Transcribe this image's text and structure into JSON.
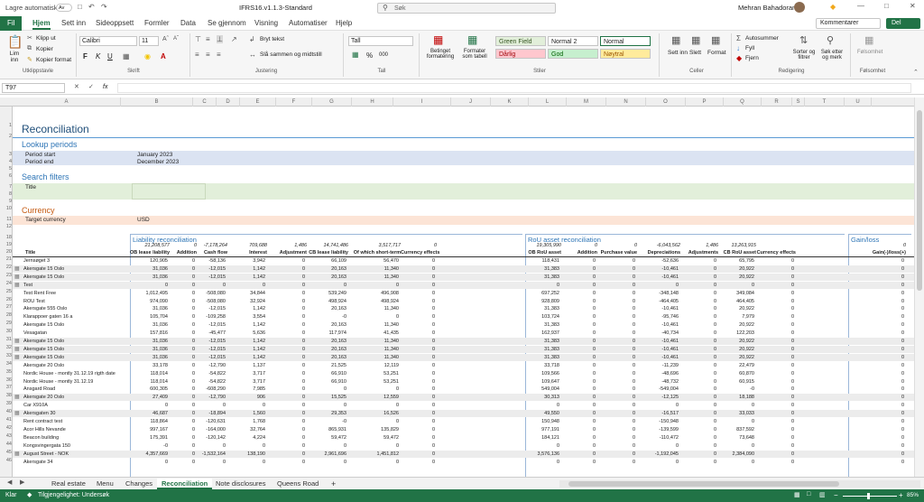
{
  "title_bar": {
    "autosave_label": "Lagre automatisk",
    "autosave_state": "Av",
    "filename": "IFRS16.v1.1.3-Standard",
    "search_placeholder": "Søk",
    "user": "Mehran Bahadoran"
  },
  "menu": {
    "items": [
      "Fil",
      "Hjem",
      "Sett inn",
      "Sideoppsett",
      "Formler",
      "Data",
      "Se gjennom",
      "Visning",
      "Automatiser",
      "Hjelp"
    ],
    "comments": "Kommentarer",
    "share": "Del"
  },
  "ribbon": {
    "clipboard": {
      "paste": "Lim inn",
      "cut": "Klipp ut",
      "copy": "Kopier",
      "format_painter": "Kopier format",
      "group": "Utklippstavle"
    },
    "font": {
      "name": "Calibri",
      "size": "11",
      "bold": "F",
      "italic": "K",
      "underline": "U",
      "group": "Skrift"
    },
    "alignment": {
      "wrap": "Bryt tekst",
      "merge": "Slå sammen og midtstill",
      "group": "Justering"
    },
    "number": {
      "format": "Tall",
      "percent": "%",
      "thousands": "000",
      "group": "Tall"
    },
    "styles": {
      "cond_format": "Betinget formatering",
      "format_table": "Formater som tabell",
      "cells": [
        {
          "label": "Green Field",
          "bg": "#e2efda",
          "fg": "#375623"
        },
        {
          "label": "Normal 2",
          "bg": "#ffffff",
          "fg": "#222222"
        },
        {
          "label": "Normal",
          "bg": "#ffffff",
          "fg": "#222222"
        },
        {
          "label": "Dårlig",
          "bg": "#ffc7ce",
          "fg": "#9c0006"
        },
        {
          "label": "God",
          "bg": "#c6efce",
          "fg": "#006100"
        },
        {
          "label": "Nøytral",
          "bg": "#ffeb9c",
          "fg": "#9c5700"
        }
      ],
      "group": "Stiler"
    },
    "cells": {
      "insert": "Sett inn",
      "delete": "Slett",
      "format": "Format",
      "group": "Celler"
    },
    "editing": {
      "autosum": "Autosummer",
      "fill": "Fyll",
      "clear": "Fjern",
      "sort": "Sorter og filtrer",
      "find": "Søk etter og merk",
      "group": "Redigering"
    },
    "sensitivity": {
      "label": "Følsomhet",
      "group": "Følsomhet"
    }
  },
  "formula_bar": {
    "name_box": "T97",
    "fx": "fx",
    "content": ""
  },
  "columns": [
    "A",
    "B",
    "C",
    "D",
    "E",
    "F",
    "G",
    "H",
    "I",
    "J",
    "K",
    "L",
    "M",
    "N",
    "O",
    "P",
    "Q",
    "R",
    "S",
    "T",
    "U"
  ],
  "sheet": {
    "title": "Reconciliation",
    "lookup": {
      "heading": "Lookup periods",
      "start_label": "Period start",
      "start_value": "January 2023",
      "end_label": "Period end",
      "end_value": "December 2023"
    },
    "search": {
      "heading": "Search filters",
      "title_label": "Title"
    },
    "currency": {
      "heading": "Currency",
      "label": "Target currency",
      "value": "USD"
    },
    "liability_heading": "Liability reconciliation",
    "rou_heading": "RoU asset reconciliation",
    "gain_heading": "Gain/loss",
    "liability_totals": [
      "21,208,577",
      "0",
      "-7,178,264",
      "709,688",
      "1,486",
      "14,741,486",
      "3,517,717",
      "0"
    ],
    "rou_totals": [
      "19,305,990",
      "0",
      "0",
      "-6,043,562",
      "1,486",
      "13,263,915"
    ],
    "gain_total": "0",
    "liability_cols": [
      "OB lease liability",
      "Addition",
      "Cash flow",
      "Interest",
      "Adjustment",
      "CB lease liability",
      "Of which short-term",
      "Currency effects"
    ],
    "rou_cols": [
      "OB RoU asset",
      "Addition",
      "Purchase value",
      "Depreciations",
      "Adjustments",
      "CB RoU asset",
      "Currency effects"
    ],
    "gain_col": "Gain(-)/loss(+)",
    "title_col": "Title",
    "rows": [
      {
        "n": 21,
        "t": "Jernsøget 3",
        "g": false,
        "l": [
          "120,905",
          "0",
          "-58,136",
          "3,942",
          "0",
          "66,109",
          "56,470",
          "0"
        ],
        "r": [
          "118,431",
          "0",
          "0",
          "-52,636",
          "0",
          "65,795",
          "0"
        ]
      },
      {
        "n": 22,
        "t": "Akersgate 15 Oslo",
        "g": true,
        "l": [
          "31,036",
          "0",
          "-12,015",
          "1,142",
          "0",
          "20,163",
          "11,340",
          "0"
        ],
        "r": [
          "31,383",
          "0",
          "0",
          "-10,461",
          "0",
          "20,922",
          "0"
        ]
      },
      {
        "n": 23,
        "t": "Akersgate 15 Oslo",
        "g": true,
        "l": [
          "31,036",
          "0",
          "-12,015",
          "1,142",
          "0",
          "20,163",
          "11,340",
          "0"
        ],
        "r": [
          "31,383",
          "0",
          "0",
          "-10,461",
          "0",
          "20,922",
          "0"
        ]
      },
      {
        "n": 24,
        "t": "Test",
        "g": true,
        "l": [
          "0",
          "0",
          "0",
          "0",
          "0",
          "0",
          "0",
          "0"
        ],
        "r": [
          "0",
          "0",
          "0",
          "0",
          "0",
          "0",
          "0"
        ]
      },
      {
        "n": 25,
        "t": "Test Rent Free",
        "g": false,
        "l": [
          "1,012,495",
          "0",
          "-508,080",
          "34,844",
          "0",
          "539,249",
          "496,908",
          "0"
        ],
        "r": [
          "697,252",
          "0",
          "0",
          "-348,148",
          "0",
          "349,084",
          "0"
        ]
      },
      {
        "n": 26,
        "t": "ROU Test",
        "g": false,
        "l": [
          "974,090",
          "0",
          "-508,080",
          "32,924",
          "0",
          "498,924",
          "498,924",
          "0"
        ],
        "r": [
          "928,809",
          "0",
          "0",
          "-464,405",
          "0",
          "464,405",
          "0"
        ]
      },
      {
        "n": 27,
        "t": "Akersgate 555 Oslo",
        "g": false,
        "l": [
          "31,036",
          "0",
          "-12,015",
          "1,142",
          "0",
          "20,163",
          "11,340",
          "0"
        ],
        "r": [
          "31,383",
          "0",
          "0",
          "-10,461",
          "0",
          "20,922",
          "0"
        ]
      },
      {
        "n": 28,
        "t": "Klarappoer gaten 16 a",
        "g": false,
        "l": [
          "105,704",
          "0",
          "-109,258",
          "3,554",
          "0",
          "-0",
          "0",
          "0"
        ],
        "r": [
          "103,724",
          "0",
          "0",
          "-95,746",
          "0",
          "7,979",
          "0"
        ]
      },
      {
        "n": 29,
        "t": "Akersgate 15 Oslo",
        "g": false,
        "l": [
          "31,036",
          "0",
          "-12,015",
          "1,142",
          "0",
          "20,163",
          "11,340",
          "0"
        ],
        "r": [
          "31,383",
          "0",
          "0",
          "-10,461",
          "0",
          "20,922",
          "0"
        ]
      },
      {
        "n": 30,
        "t": "Vesagatan",
        "g": false,
        "l": [
          "157,816",
          "0",
          "-45,477",
          "5,636",
          "0",
          "117,974",
          "41,435",
          "0"
        ],
        "r": [
          "162,937",
          "0",
          "0",
          "-40,734",
          "0",
          "122,203",
          "0"
        ]
      },
      {
        "n": 31,
        "t": "Akersgate 15 Oslo",
        "g": true,
        "l": [
          "31,036",
          "0",
          "-12,015",
          "1,142",
          "0",
          "20,163",
          "11,340",
          "0"
        ],
        "r": [
          "31,383",
          "0",
          "0",
          "-10,461",
          "0",
          "20,922",
          "0"
        ]
      },
      {
        "n": 32,
        "t": "Akersgate 15 Oslo",
        "g": true,
        "l": [
          "31,036",
          "0",
          "-12,015",
          "1,142",
          "0",
          "20,163",
          "11,340",
          "0"
        ],
        "r": [
          "31,383",
          "0",
          "0",
          "-10,461",
          "0",
          "20,922",
          "0"
        ]
      },
      {
        "n": 33,
        "t": "Akersgate 15 Oslo",
        "g": true,
        "l": [
          "31,036",
          "0",
          "-12,015",
          "1,142",
          "0",
          "20,163",
          "11,340",
          "0"
        ],
        "r": [
          "31,383",
          "0",
          "0",
          "-10,461",
          "0",
          "20,922",
          "0"
        ]
      },
      {
        "n": 34,
        "t": "Akersgate 20 Oslo",
        "g": false,
        "l": [
          "33,178",
          "0",
          "-12,790",
          "1,137",
          "0",
          "21,525",
          "12,119",
          "0"
        ],
        "r": [
          "33,718",
          "0",
          "0",
          "-11,239",
          "0",
          "22,479",
          "0"
        ]
      },
      {
        "n": 35,
        "t": "Nordic House - montly 31.12.19 rigth date",
        "g": false,
        "l": [
          "118,014",
          "0",
          "-54,822",
          "3,717",
          "0",
          "66,910",
          "53,251",
          "0"
        ],
        "r": [
          "109,566",
          "0",
          "0",
          "-48,696",
          "0",
          "60,870",
          "0"
        ]
      },
      {
        "n": 36,
        "t": "Nordic House - montly 31.12.19",
        "g": false,
        "l": [
          "118,014",
          "0",
          "-54,822",
          "3,717",
          "0",
          "66,910",
          "53,251",
          "0"
        ],
        "r": [
          "109,647",
          "0",
          "0",
          "-48,732",
          "0",
          "60,915",
          "0"
        ]
      },
      {
        "n": 37,
        "t": "Ansgard Road",
        "g": false,
        "l": [
          "600,305",
          "0",
          "-608,290",
          "7,985",
          "0",
          "0",
          "0",
          "0"
        ],
        "r": [
          "549,004",
          "0",
          "0",
          "-549,004",
          "0",
          "-0",
          "0"
        ]
      },
      {
        "n": 38,
        "t": "Akersgate 20 Oslo",
        "g": true,
        "l": [
          "27,409",
          "0",
          "-12,790",
          "906",
          "0",
          "15,525",
          "12,559",
          "0"
        ],
        "r": [
          "30,313",
          "0",
          "0",
          "-12,125",
          "0",
          "18,188",
          "0"
        ]
      },
      {
        "n": 39,
        "t": "Car X910A",
        "g": false,
        "l": [
          "0",
          "0",
          "0",
          "0",
          "0",
          "0",
          "0",
          "0"
        ],
        "r": [
          "0",
          "0",
          "0",
          "0",
          "0",
          "0",
          "0"
        ]
      },
      {
        "n": 40,
        "t": "Akersgaten 30",
        "g": true,
        "l": [
          "46,687",
          "0",
          "-18,894",
          "1,560",
          "0",
          "29,353",
          "16,526",
          "0"
        ],
        "r": [
          "49,550",
          "0",
          "0",
          "-16,517",
          "0",
          "33,033",
          "0"
        ]
      },
      {
        "n": 41,
        "t": "Rent contract test",
        "g": false,
        "l": [
          "118,864",
          "0",
          "-120,631",
          "1,768",
          "0",
          "-0",
          "0",
          "0"
        ],
        "r": [
          "150,948",
          "0",
          "0",
          "-150,948",
          "0",
          "0",
          "0"
        ]
      },
      {
        "n": 42,
        "t": "Acor Hills Nevande",
        "g": false,
        "l": [
          "997,167",
          "0",
          "-164,000",
          "32,764",
          "0",
          "865,931",
          "135,829",
          "0"
        ],
        "r": [
          "977,191",
          "0",
          "0",
          "-139,599",
          "0",
          "837,592",
          "0"
        ]
      },
      {
        "n": 43,
        "t": "Beacon building",
        "g": false,
        "l": [
          "175,391",
          "0",
          "-120,142",
          "4,224",
          "0",
          "59,472",
          "59,472",
          "0"
        ],
        "r": [
          "184,121",
          "0",
          "0",
          "-110,472",
          "0",
          "73,648",
          "0"
        ]
      },
      {
        "n": 44,
        "t": "Kongsvingergata 150",
        "g": false,
        "l": [
          "-0",
          "0",
          "0",
          "0",
          "0",
          "0",
          "0",
          "0"
        ],
        "r": [
          "0",
          "0",
          "0",
          "0",
          "0",
          "0",
          "0"
        ]
      },
      {
        "n": 45,
        "t": "August Street - NOK",
        "g": true,
        "l": [
          "4,357,669",
          "0",
          "-1,532,164",
          "138,190",
          "0",
          "2,961,696",
          "1,451,812",
          "0"
        ],
        "r": [
          "3,576,136",
          "0",
          "0",
          "-1,192,045",
          "0",
          "2,384,090",
          "0"
        ]
      },
      {
        "n": 46,
        "t": "Akersgate 34",
        "g": false,
        "l": [
          "0",
          "0",
          "0",
          "0",
          "0",
          "0",
          "0",
          "0"
        ],
        "r": [
          "0",
          "0",
          "0",
          "0",
          "0",
          "0",
          "0"
        ]
      }
    ]
  },
  "tabs": {
    "items": [
      "Real estate",
      "Menu",
      "Changes",
      "Reconciliation",
      "Note disclosures",
      "Queens Road"
    ],
    "active": "Reconciliation",
    "add": "+"
  },
  "status": {
    "mode": "Klar",
    "accessibility": "Tilgjengelighet: Undersøk",
    "zoom": "85%"
  }
}
